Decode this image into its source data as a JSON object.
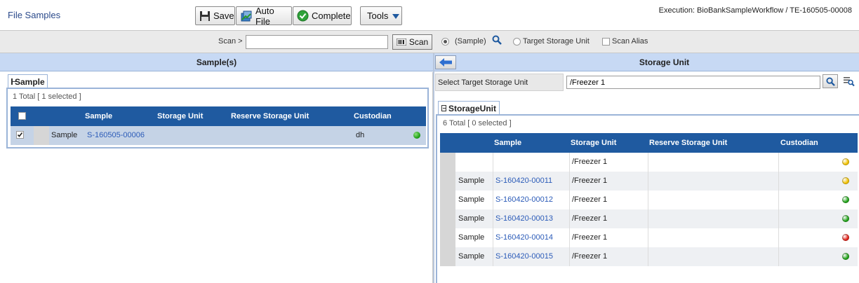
{
  "page_title": "File Samples",
  "toolbar": {
    "save_label": "Save",
    "autofile_label": "Auto File",
    "complete_label": "Complete",
    "tools_label": "Tools"
  },
  "execution_text": "Execution: BioBankSampleWorkflow / TE-160505-00008",
  "scan": {
    "label": "Scan >",
    "value": "",
    "button_label": "Scan",
    "options": [
      {
        "label": "(Sample)",
        "selected": true
      },
      {
        "label": "Target Storage Unit",
        "selected": false
      }
    ],
    "alias_label": "Scan Alias",
    "alias_checked": false
  },
  "left": {
    "header": "Sample(s)",
    "tab": "Sample",
    "total": "1 Total [ 1 selected ]",
    "columns": [
      "Sample",
      "Storage Unit",
      "Reserve Storage Unit",
      "Custodian"
    ],
    "rows": [
      {
        "type": "Sample",
        "id": "S-160505-00006",
        "storage": "",
        "reserve": "",
        "custodian": "dh",
        "status_color": "#22a31a",
        "checked": true
      }
    ]
  },
  "right": {
    "header": "Storage Unit",
    "target_label": "Select Target Storage Unit",
    "target_value": "/Freezer 1",
    "tab": "StorageUnit",
    "total": "6 Total [ 0 selected ]",
    "columns": [
      "Sample",
      "Storage Unit",
      "Reserve Storage Unit",
      "Custodian"
    ],
    "rows": [
      {
        "type": "",
        "id": "",
        "storage": "/Freezer 1",
        "status_color": "#f2c200"
      },
      {
        "type": "Sample",
        "id": "S-160420-00011",
        "storage": "/Freezer 1",
        "status_color": "#f2c200"
      },
      {
        "type": "Sample",
        "id": "S-160420-00012",
        "storage": "/Freezer 1",
        "status_color": "#22a31a"
      },
      {
        "type": "Sample",
        "id": "S-160420-00013",
        "storage": "/Freezer 1",
        "status_color": "#22a31a"
      },
      {
        "type": "Sample",
        "id": "S-160420-00014",
        "storage": "/Freezer 1",
        "status_color": "#e0231a"
      },
      {
        "type": "Sample",
        "id": "S-160420-00015",
        "storage": "/Freezer 1",
        "status_color": "#22a31a"
      }
    ]
  }
}
